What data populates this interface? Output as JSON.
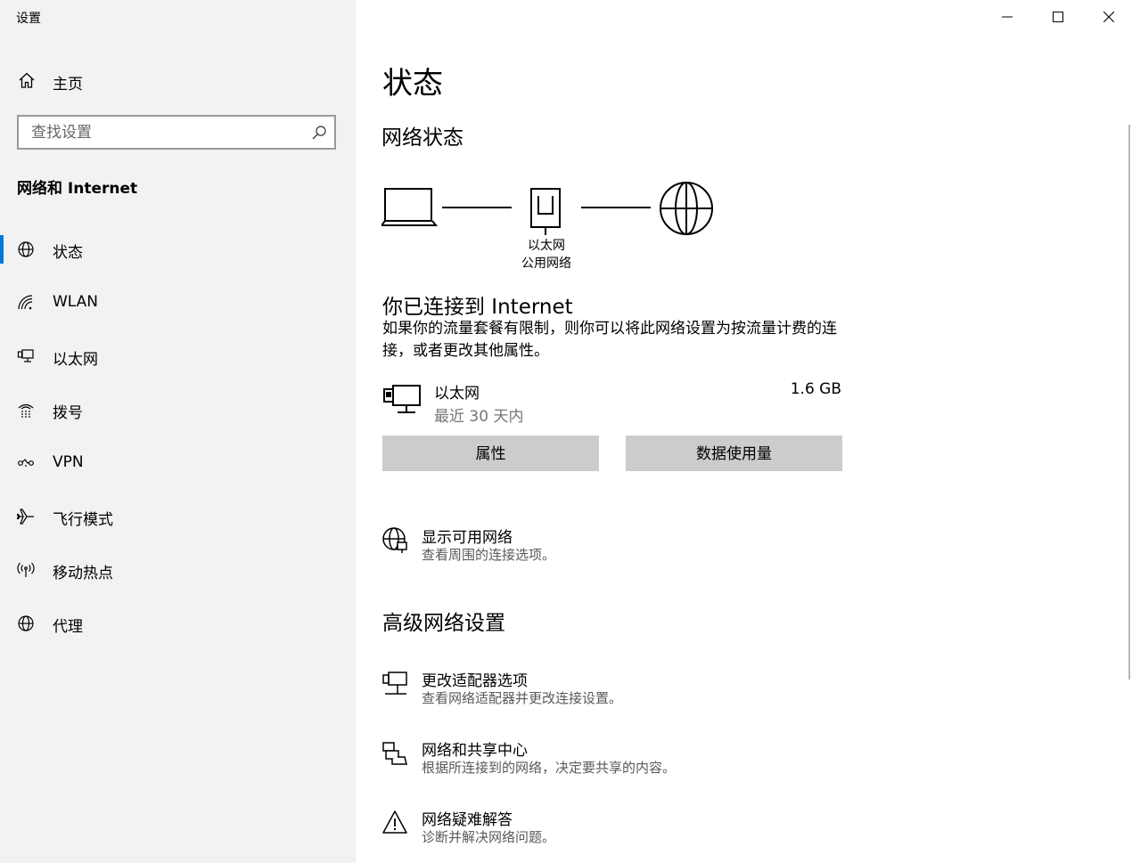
{
  "window": {
    "title": "设置"
  },
  "sidebar": {
    "home_label": "主页",
    "search_placeholder": "查找设置",
    "section_title": "网络和 Internet",
    "items": [
      {
        "label": "状态",
        "icon": "globe-icon",
        "selected": true
      },
      {
        "label": "WLAN",
        "icon": "wifi-icon"
      },
      {
        "label": "以太网",
        "icon": "ethernet-icon"
      },
      {
        "label": "拨号",
        "icon": "dialup-icon"
      },
      {
        "label": "VPN",
        "icon": "vpn-icon"
      },
      {
        "label": "飞行模式",
        "icon": "airplane-icon"
      },
      {
        "label": "移动热点",
        "icon": "hotspot-icon"
      },
      {
        "label": "代理",
        "icon": "globe-icon"
      }
    ]
  },
  "main": {
    "page_title": "状态",
    "network_status_heading": "网络状态",
    "diagram": {
      "adapter_label": "以太网",
      "network_type": "公用网络"
    },
    "connected_heading": "你已连接到 Internet",
    "connected_description": "如果你的流量套餐有限制，则你可以将此网络设置为按流量计费的连接，或者更改其他属性。",
    "usage": {
      "name": "以太网",
      "period": "最近 30 天内",
      "amount": "1.6 GB"
    },
    "buttons": {
      "properties": "属性",
      "data_usage": "数据使用量"
    },
    "show_networks": {
      "title": "显示可用网络",
      "subtitle": "查看周围的连接选项。"
    },
    "advanced_heading": "高级网络设置",
    "advanced_items": [
      {
        "title": "更改适配器选项",
        "subtitle": "查看网络适配器并更改连接设置。",
        "icon": "adapter-icon"
      },
      {
        "title": "网络和共享中心",
        "subtitle": "根据所连接到的网络，决定要共享的内容。",
        "icon": "sharing-center-icon"
      },
      {
        "title": "网络疑难解答",
        "subtitle": "诊断并解决网络问题。",
        "icon": "warning-icon"
      }
    ]
  },
  "colors": {
    "accent": "#0078d7",
    "sidebar_bg": "#f2f2f2",
    "button_bg": "#cccccc"
  }
}
